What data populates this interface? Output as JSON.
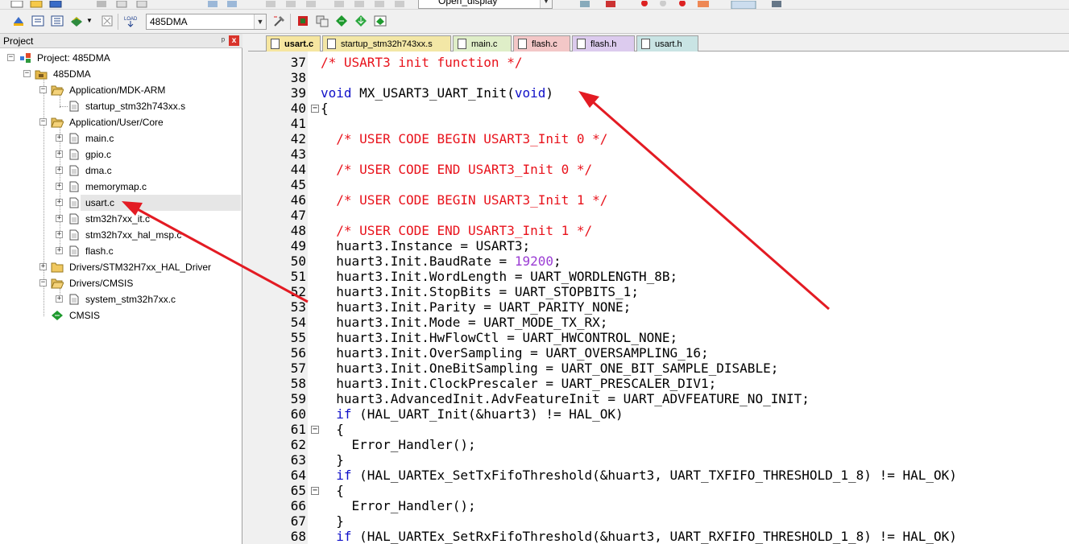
{
  "toolbar": {
    "target_name": "485DMA",
    "find_combo": "Open_display"
  },
  "project_panel": {
    "title": "Project",
    "pin_glyph": "ᵖ",
    "close_glyph": "x",
    "tree": [
      {
        "label": "Project: 485DMA"
      },
      {
        "label": "485DMA"
      },
      {
        "label": "Application/MDK-ARM"
      },
      {
        "label": "startup_stm32h743xx.s"
      },
      {
        "label": "Application/User/Core"
      },
      {
        "label": "main.c"
      },
      {
        "label": "gpio.c"
      },
      {
        "label": "dma.c"
      },
      {
        "label": "memorymap.c"
      },
      {
        "label": "usart.c"
      },
      {
        "label": "stm32h7xx_it.c"
      },
      {
        "label": "stm32h7xx_hal_msp.c"
      },
      {
        "label": "flash.c"
      },
      {
        "label": "Drivers/STM32H7xx_HAL_Driver"
      },
      {
        "label": "Drivers/CMSIS"
      },
      {
        "label": "system_stm32h7xx.c"
      },
      {
        "label": "CMSIS"
      }
    ]
  },
  "tabs": [
    {
      "label": "usart.c",
      "color": "#f6e6a0"
    },
    {
      "label": "startup_stm32h743xx.s",
      "color": "#f3e7a6"
    },
    {
      "label": "main.c",
      "color": "#dfeec8"
    },
    {
      "label": "flash.c",
      "color": "#f3c7c7"
    },
    {
      "label": "flash.h",
      "color": "#dccbee"
    },
    {
      "label": "usart.h",
      "color": "#c9e4e4"
    }
  ],
  "editor": {
    "lines": [
      {
        "n": "37",
        "fold": "",
        "parts": [
          {
            "t": "/* USART3 init function */",
            "c": "cm"
          }
        ]
      },
      {
        "n": "38",
        "fold": "",
        "parts": []
      },
      {
        "n": "39",
        "fold": "",
        "parts": [
          {
            "t": "void",
            "c": "kw"
          },
          {
            "t": " MX_USART3_UART_Init(",
            "c": ""
          },
          {
            "t": "void",
            "c": "kw"
          },
          {
            "t": ")",
            "c": ""
          }
        ]
      },
      {
        "n": "40",
        "fold": "⊟",
        "parts": [
          {
            "t": "{",
            "c": ""
          }
        ]
      },
      {
        "n": "41",
        "fold": "",
        "parts": []
      },
      {
        "n": "42",
        "fold": "",
        "parts": [
          {
            "t": "  /* USER CODE BEGIN USART3_Init 0 */",
            "c": "cm"
          }
        ]
      },
      {
        "n": "43",
        "fold": "",
        "parts": []
      },
      {
        "n": "44",
        "fold": "",
        "parts": [
          {
            "t": "  /* USER CODE END USART3_Init 0 */",
            "c": "cm"
          }
        ]
      },
      {
        "n": "45",
        "fold": "",
        "parts": []
      },
      {
        "n": "46",
        "fold": "",
        "parts": [
          {
            "t": "  /* USER CODE BEGIN USART3_Init 1 */",
            "c": "cm"
          }
        ]
      },
      {
        "n": "47",
        "fold": "",
        "parts": []
      },
      {
        "n": "48",
        "fold": "",
        "parts": [
          {
            "t": "  /* USER CODE END USART3_Init 1 */",
            "c": "cm"
          }
        ]
      },
      {
        "n": "49",
        "fold": "",
        "parts": [
          {
            "t": "  huart3.Instance = USART3;",
            "c": ""
          }
        ]
      },
      {
        "n": "50",
        "fold": "",
        "parts": [
          {
            "t": "  huart3.Init.BaudRate = ",
            "c": ""
          },
          {
            "t": "19200",
            "c": "num"
          },
          {
            "t": ";",
            "c": ""
          }
        ]
      },
      {
        "n": "51",
        "fold": "",
        "parts": [
          {
            "t": "  huart3.Init.WordLength = UART_WORDLENGTH_8B;",
            "c": ""
          }
        ]
      },
      {
        "n": "52",
        "fold": "",
        "parts": [
          {
            "t": "  huart3.Init.StopBits = UART_STOPBITS_1;",
            "c": ""
          }
        ]
      },
      {
        "n": "53",
        "fold": "",
        "parts": [
          {
            "t": "  huart3.Init.Parity = UART_PARITY_NONE;",
            "c": ""
          }
        ]
      },
      {
        "n": "54",
        "fold": "",
        "parts": [
          {
            "t": "  huart3.Init.Mode = UART_MODE_TX_RX;",
            "c": ""
          }
        ]
      },
      {
        "n": "55",
        "fold": "",
        "parts": [
          {
            "t": "  huart3.Init.HwFlowCtl = UART_HWCONTROL_NONE;",
            "c": ""
          }
        ]
      },
      {
        "n": "56",
        "fold": "",
        "parts": [
          {
            "t": "  huart3.Init.OverSampling = UART_OVERSAMPLING_16;",
            "c": ""
          }
        ]
      },
      {
        "n": "57",
        "fold": "",
        "parts": [
          {
            "t": "  huart3.Init.OneBitSampling = UART_ONE_BIT_SAMPLE_DISABLE;",
            "c": ""
          }
        ]
      },
      {
        "n": "58",
        "fold": "",
        "parts": [
          {
            "t": "  huart3.Init.ClockPrescaler = UART_PRESCALER_DIV1;",
            "c": ""
          }
        ]
      },
      {
        "n": "59",
        "fold": "",
        "parts": [
          {
            "t": "  huart3.AdvancedInit.AdvFeatureInit = UART_ADVFEATURE_NO_INIT;",
            "c": ""
          }
        ]
      },
      {
        "n": "60",
        "fold": "",
        "parts": [
          {
            "t": "  ",
            "c": ""
          },
          {
            "t": "if",
            "c": "kw"
          },
          {
            "t": " (HAL_UART_Init(&huart3) != HAL_OK)",
            "c": ""
          }
        ]
      },
      {
        "n": "61",
        "fold": "⊟",
        "parts": [
          {
            "t": "  {",
            "c": ""
          }
        ]
      },
      {
        "n": "62",
        "fold": "",
        "parts": [
          {
            "t": "    Error_Handler();",
            "c": ""
          }
        ]
      },
      {
        "n": "63",
        "fold": "",
        "parts": [
          {
            "t": "  }",
            "c": ""
          }
        ]
      },
      {
        "n": "64",
        "fold": "",
        "parts": [
          {
            "t": "  ",
            "c": ""
          },
          {
            "t": "if",
            "c": "kw"
          },
          {
            "t": " (HAL_UARTEx_SetTxFifoThreshold(&huart3, UART_TXFIFO_THRESHOLD_1_8) != HAL_OK)",
            "c": ""
          }
        ]
      },
      {
        "n": "65",
        "fold": "⊟",
        "parts": [
          {
            "t": "  {",
            "c": ""
          }
        ]
      },
      {
        "n": "66",
        "fold": "",
        "parts": [
          {
            "t": "    Error_Handler();",
            "c": ""
          }
        ]
      },
      {
        "n": "67",
        "fold": "",
        "parts": [
          {
            "t": "  }",
            "c": ""
          }
        ]
      },
      {
        "n": "68",
        "fold": "",
        "parts": [
          {
            "t": "  ",
            "c": ""
          },
          {
            "t": "if",
            "c": "kw"
          },
          {
            "t": " (HAL_UARTEx_SetRxFifoThreshold(&huart3, UART_RXFIFO_THRESHOLD_1_8) != HAL_OK)",
            "c": ""
          }
        ]
      }
    ]
  },
  "colors": {
    "comment": "#e8121b",
    "keyword": "#1010c8",
    "number": "#9b3dd4",
    "annotation_arrow": "#e31b23"
  }
}
